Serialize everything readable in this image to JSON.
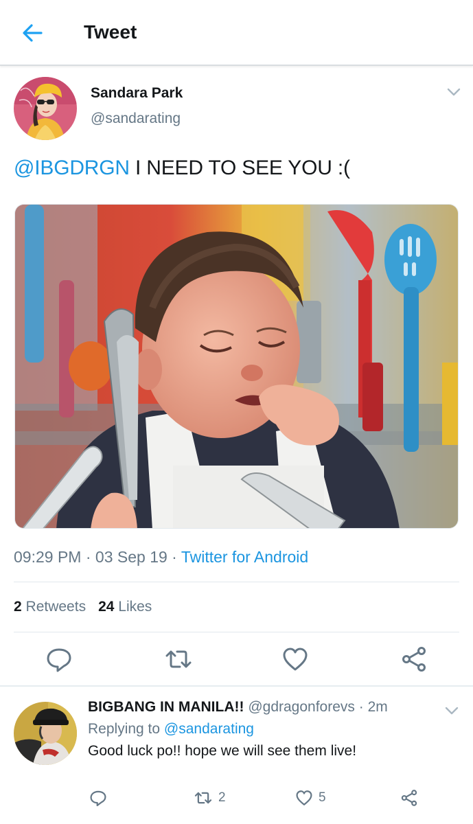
{
  "header": {
    "title": "Tweet"
  },
  "tweet": {
    "author_name": "Sandara Park",
    "author_handle": "@sandarating",
    "text_mention": "@IBGDRGN",
    "text_body": " I NEED TO SEE YOU :(",
    "time": "09:29 PM",
    "date": "03 Sep 19",
    "source": "Twitter for Android",
    "retweet_count": "2",
    "retweet_label": "Retweets",
    "like_count": "24",
    "like_label": "Likes"
  },
  "reply": {
    "author_name": "BIGBANG IN MANILA!!",
    "author_handle": "@gdragonforevs",
    "time_ago": "2m",
    "replying_prefix": "Replying to",
    "replying_to": "@sandarating",
    "text": "Good luck po!! hope we will see them live!",
    "retweet_count": "2",
    "like_count": "5"
  },
  "colors": {
    "accent": "#1b95e0",
    "secondary_text": "#657786",
    "icon": "#657786"
  }
}
